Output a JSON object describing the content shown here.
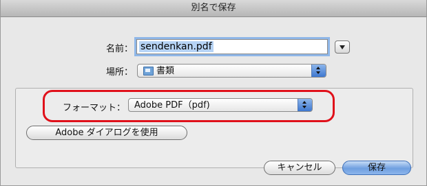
{
  "window": {
    "title": "別名で保存"
  },
  "name_row": {
    "label": "名前：",
    "value": "sendenkan.pdf"
  },
  "location_row": {
    "label": "場所：",
    "selected": "書類",
    "icon": "folder-icon"
  },
  "format_row": {
    "label": "フォーマット：",
    "selected": "Adobe PDF（pdf)"
  },
  "buttons": {
    "adobe_dialog": "Adobe ダイアログを使用",
    "cancel": "キャンセル",
    "save": "保存"
  },
  "colors": {
    "highlight": "#e0101a",
    "accent": "#3e77cf",
    "selection": "#b6d3f5"
  }
}
